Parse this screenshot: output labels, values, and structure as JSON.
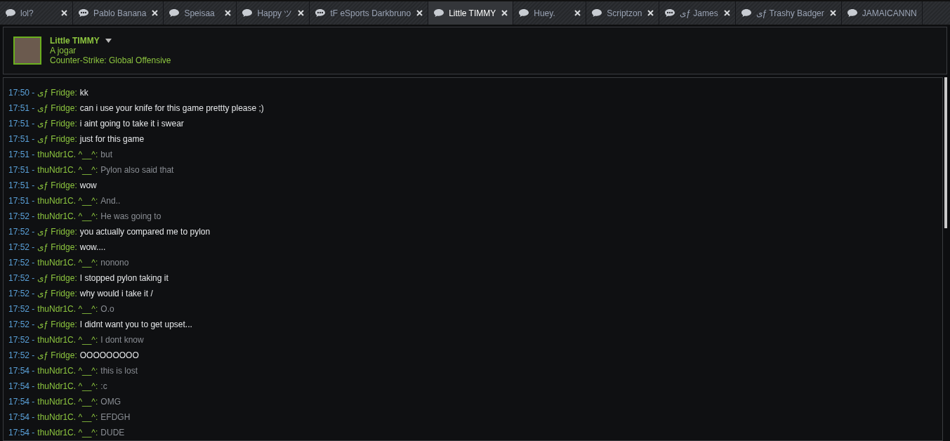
{
  "tabs": [
    {
      "label": "lol?",
      "kind": "chat",
      "selected": false
    },
    {
      "label": "Pablo Banana",
      "kind": "chat-dots",
      "selected": false
    },
    {
      "label": "Speisaa",
      "kind": "chat",
      "selected": false
    },
    {
      "label": "Happy ツ",
      "kind": "chat",
      "selected": false
    },
    {
      "label": "tF eSports Darkbruno",
      "kind": "chat-dots",
      "selected": false
    },
    {
      "label": "Little TIMMY",
      "kind": "chat",
      "selected": true
    },
    {
      "label": "Huey.",
      "kind": "chat",
      "selected": false
    },
    {
      "label": "Scriptzon",
      "kind": "chat",
      "selected": false
    },
    {
      "label": "ىƒ James",
      "kind": "chat-dots",
      "selected": false
    },
    {
      "label": "ىƒ Trashy Badger",
      "kind": "chat",
      "selected": false
    },
    {
      "label": "JAMAICANNN",
      "kind": "chat",
      "selected": false
    }
  ],
  "profile": {
    "name": "Little TIMMY",
    "status": "A jogar",
    "game": "Counter-Strike: Global Offensive"
  },
  "messages": [
    {
      "time": "17:50 -",
      "sender": "ىƒ Fridge:",
      "kind": "self",
      "text": "kk"
    },
    {
      "time": "17:51 -",
      "sender": "ىƒ Fridge:",
      "kind": "self",
      "text": "can i use your knife for this game prettty please ;)"
    },
    {
      "time": "17:51 -",
      "sender": "ىƒ Fridge:",
      "kind": "self",
      "text": "i aint going to take it i swear"
    },
    {
      "time": "17:51 -",
      "sender": "ىƒ Fridge:",
      "kind": "self",
      "text": "just for this game"
    },
    {
      "time": "17:51 -",
      "sender": "thuNdr1C. ^__^:",
      "kind": "friend",
      "text": "but"
    },
    {
      "time": "17:51 -",
      "sender": "thuNdr1C. ^__^:",
      "kind": "friend",
      "text": "Pylon also said that"
    },
    {
      "time": "17:51 -",
      "sender": "ىƒ Fridge:",
      "kind": "self",
      "text": "wow"
    },
    {
      "time": "17:51 -",
      "sender": "thuNdr1C. ^__^:",
      "kind": "friend",
      "text": "And.."
    },
    {
      "time": "17:52 -",
      "sender": "thuNdr1C. ^__^:",
      "kind": "friend",
      "text": "He was going to"
    },
    {
      "time": "17:52 -",
      "sender": "ىƒ Fridge:",
      "kind": "self",
      "text": "you actually compared me to pylon"
    },
    {
      "time": "17:52 -",
      "sender": "ىƒ Fridge:",
      "kind": "self",
      "text": "wow...."
    },
    {
      "time": "17:52 -",
      "sender": "thuNdr1C. ^__^:",
      "kind": "friend",
      "text": "nonono"
    },
    {
      "time": "17:52 -",
      "sender": "ىƒ Fridge:",
      "kind": "self",
      "text": "I stopped pylon taking it"
    },
    {
      "time": "17:52 -",
      "sender": "ىƒ Fridge:",
      "kind": "self",
      "text": "why would i take it /"
    },
    {
      "time": "17:52 -",
      "sender": "thuNdr1C. ^__^:",
      "kind": "friend",
      "text": "O.o"
    },
    {
      "time": "17:52 -",
      "sender": "ىƒ Fridge:",
      "kind": "self",
      "text": "I didnt want you to get upset..."
    },
    {
      "time": "17:52 -",
      "sender": "thuNdr1C. ^__^:",
      "kind": "friend",
      "text": "I dont know"
    },
    {
      "time": "17:52 -",
      "sender": "ىƒ Fridge:",
      "kind": "self",
      "text": "OOOOOOOOO"
    },
    {
      "time": "17:54 -",
      "sender": "thuNdr1C. ^__^:",
      "kind": "friend",
      "text": "this is lost"
    },
    {
      "time": "17:54 -",
      "sender": "thuNdr1C. ^__^:",
      "kind": "friend",
      "text": ":c"
    },
    {
      "time": "17:54 -",
      "sender": "thuNdr1C. ^__^:",
      "kind": "friend",
      "text": "OMG"
    },
    {
      "time": "17:54 -",
      "sender": "thuNdr1C. ^__^:",
      "kind": "friend",
      "text": "EFDGH"
    },
    {
      "time": "17:54 -",
      "sender": "thuNdr1C. ^__^:",
      "kind": "friend",
      "text": "DUDE"
    }
  ]
}
